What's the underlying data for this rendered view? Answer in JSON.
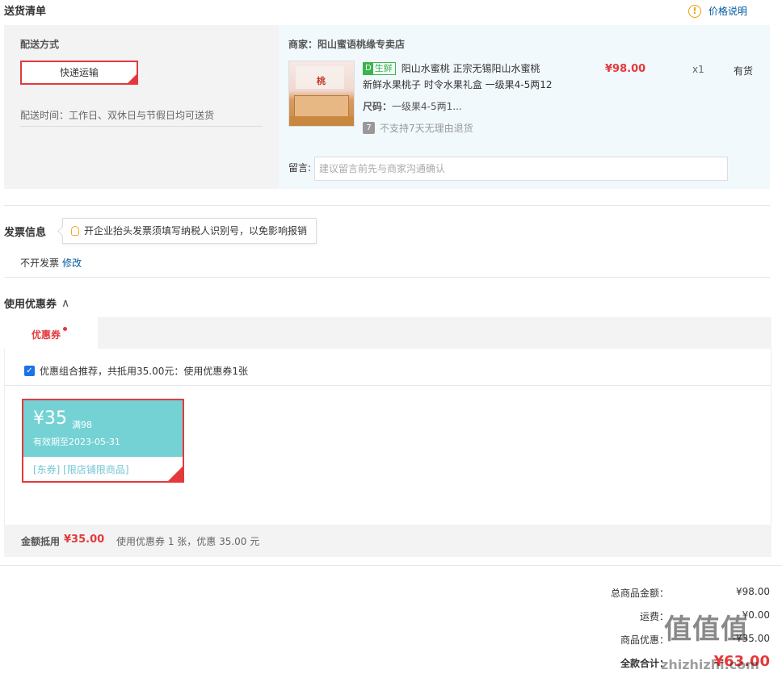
{
  "header": {
    "title": "送货清单",
    "price_help": "价格说明",
    "help_icon": "!"
  },
  "shipping": {
    "method_label": "配送方式",
    "method_value": "快递运输",
    "time_text": "配送时间：工作日、双休日与节假日均可送货"
  },
  "merchant": {
    "name": "商家：阳山蜜语桃缘专卖店"
  },
  "product": {
    "fresh_icon": "D",
    "fresh_tag": "生鲜",
    "title_line1": "阳山水蜜桃 正宗无锡阳山水蜜桃",
    "title_line2": "新鲜水果桃子 时令水果礼盒 一级果4-5两12",
    "spec_label": "尺码：",
    "spec_value": "一级果4-5两1...",
    "return_icon": "7",
    "return_text": "不支持7天无理由退货",
    "price": "¥98.00",
    "qty": "x1",
    "stock": "有货",
    "thumb_text": "桃"
  },
  "remark": {
    "label": "留言:",
    "placeholder": "建议留言前先与商家沟通确认"
  },
  "invoice": {
    "title": "发票信息",
    "tip": "开企业抬头发票须填写纳税人识别号，以免影响报销",
    "status": "不开发票",
    "edit": "修改"
  },
  "coupons": {
    "title": "使用优惠券",
    "toggle_icon": "∧",
    "tab": "优惠券",
    "combo_text": "优惠组合推荐，共抵用35.00元：使用优惠券1张",
    "checkbox_mark": "✓",
    "card": {
      "amount": "¥35",
      "condition": "满98",
      "valid": "有效期至2023-05-31",
      "scope": "[东券] [限店铺限商品]"
    },
    "footer_label": "金额抵用",
    "footer_amount": "¥35.00",
    "footer_text": "使用优惠券 1 张，优惠 35.00 元"
  },
  "totals": {
    "goods_label": "总商品金额：",
    "goods_value": "¥98.00",
    "shipping_label": "运费：",
    "shipping_value": "¥0.00",
    "discount_label": "商品优惠：",
    "discount_value": "-¥35.00",
    "grand_label": "全款合计：",
    "grand_value": "¥63.00"
  },
  "watermark": {
    "main": "值值值",
    "sub": "zhizhizhi.com"
  },
  "colors": {
    "accent_red": "#e4393c",
    "link_blue": "#005aa0",
    "coupon_teal": "#74d2d4",
    "fresh_green": "#3cb44b"
  }
}
